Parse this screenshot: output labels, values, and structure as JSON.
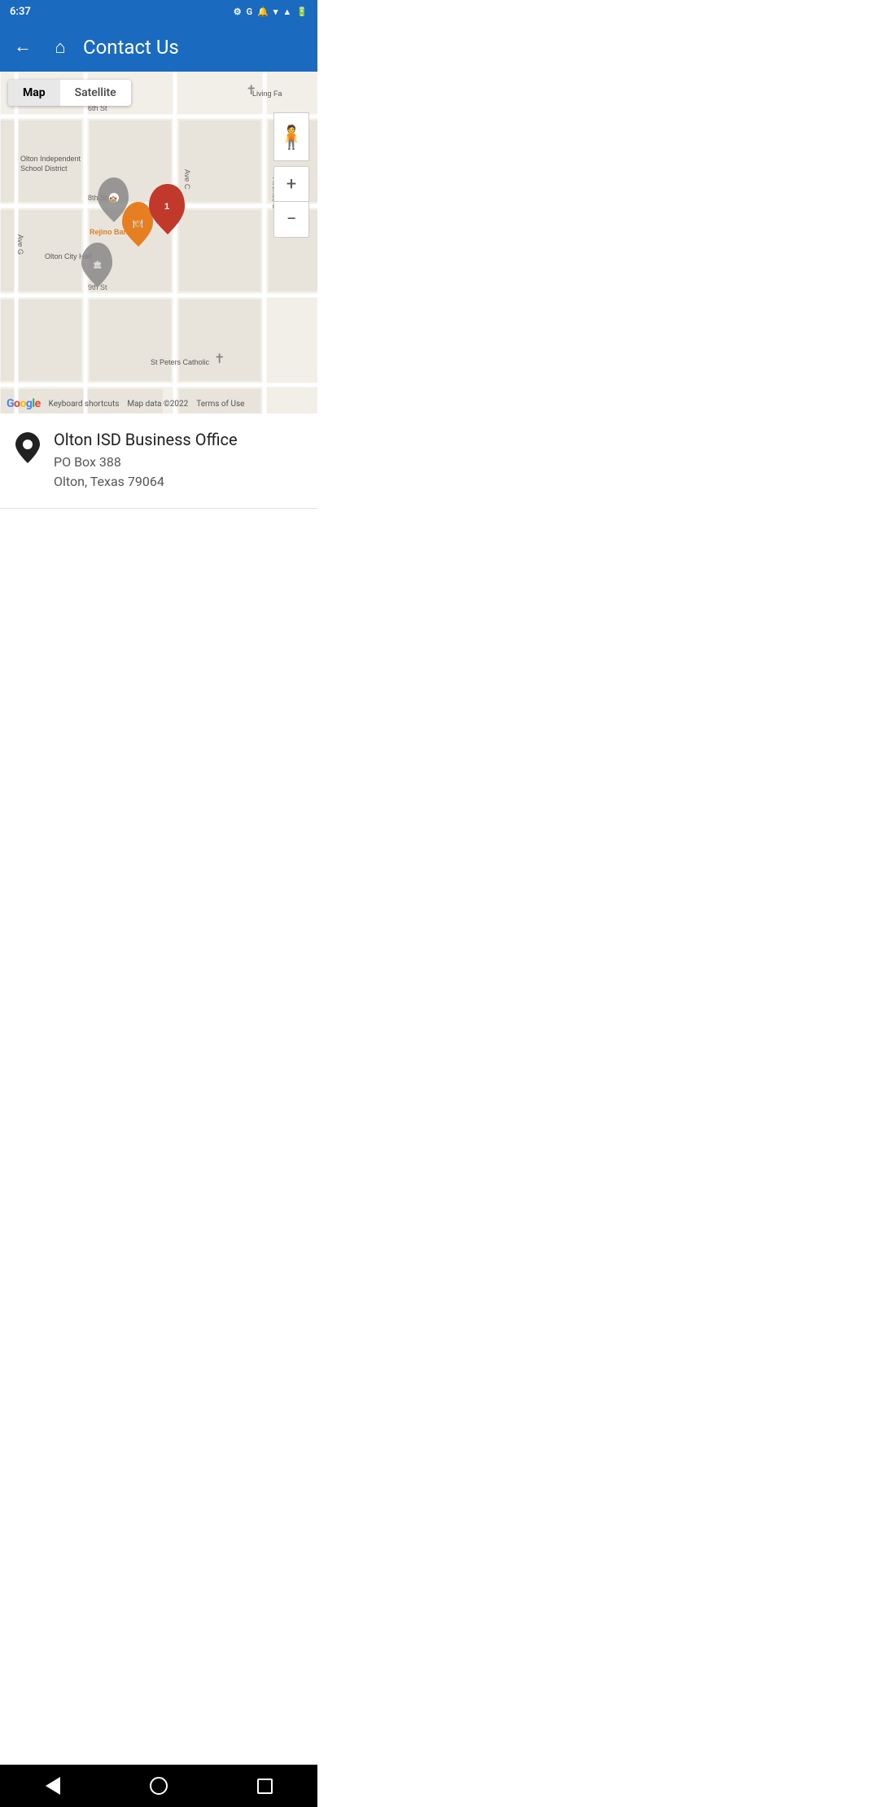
{
  "statusBar": {
    "time": "6:37",
    "icons": [
      "settings",
      "google",
      "notification"
    ]
  },
  "toolbar": {
    "title": "Contact Us",
    "backLabel": "←",
    "homeLabel": "⌂"
  },
  "map": {
    "tabs": [
      {
        "label": "Map",
        "active": true
      },
      {
        "label": "Satellite",
        "active": false
      }
    ],
    "attribution": {
      "keyboard": "Keyboard shortcuts",
      "data": "Map data ©2022",
      "terms": "Terms of Use"
    },
    "controls": {
      "zoomIn": "+",
      "zoomOut": "−",
      "pegman": "🧍"
    },
    "labels": {
      "schoolDistrict": "Olton Independent School District",
      "cityHall": "Olton City Hall",
      "barbeque": "Rejino Barbeque",
      "stPeters": "St Peters Catholic",
      "livingFa": "Living Fa",
      "street6th": "6th St",
      "street8th": "8th St",
      "street9th": "9th St",
      "aveC": "Ave C",
      "aveB": "Avenue B",
      "aveG": "Ave G"
    }
  },
  "locationCard": {
    "name": "Olton ISD Business Office",
    "addressLine1": "PO Box 388",
    "addressLine2": "Olton, Texas  79064"
  },
  "navBar": {
    "back": "back",
    "home": "home",
    "recents": "recents"
  }
}
